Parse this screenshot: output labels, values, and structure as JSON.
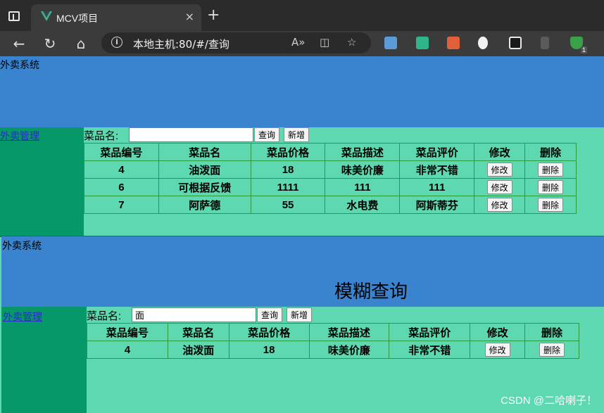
{
  "browser": {
    "tab_title": "MCV项目",
    "tab_close": "×",
    "new_tab": "+",
    "address": "本地主机:80/#/查询",
    "icons": [
      "back-icon",
      "refresh-icon",
      "home-icon",
      "info-icon",
      "read-aloud-icon",
      "split-screen-icon",
      "favorite-icon"
    ],
    "extensions_badge": "1"
  },
  "page": {
    "system_title": "外卖系统",
    "nav_link": "外卖管理",
    "search_label": "菜品名:",
    "query_button": "查询",
    "add_button": "新增",
    "columns": [
      "菜品编号",
      "菜品名",
      "菜品价格",
      "菜品描述",
      "菜品评价",
      "修改",
      "删除"
    ],
    "edit_label": "修改",
    "delete_label": "删除"
  },
  "panel1": {
    "search_value": "",
    "rows": [
      {
        "id": "4",
        "name": "油泼面",
        "price": "18",
        "desc": "味美价廉",
        "review": "非常不错"
      },
      {
        "id": "6",
        "name": "可根据反馈",
        "price": "1111",
        "desc": "111",
        "review": "111"
      },
      {
        "id": "7",
        "name": "阿萨德",
        "price": "55",
        "desc": "水电费",
        "review": "阿斯蒂芬"
      }
    ]
  },
  "panel2": {
    "heading": "模糊查询",
    "search_value": "面",
    "rows": [
      {
        "id": "4",
        "name": "油泼面",
        "price": "18",
        "desc": "味美价廉",
        "review": "非常不错"
      }
    ]
  },
  "watermark": "CSDN @二哈喇子！"
}
